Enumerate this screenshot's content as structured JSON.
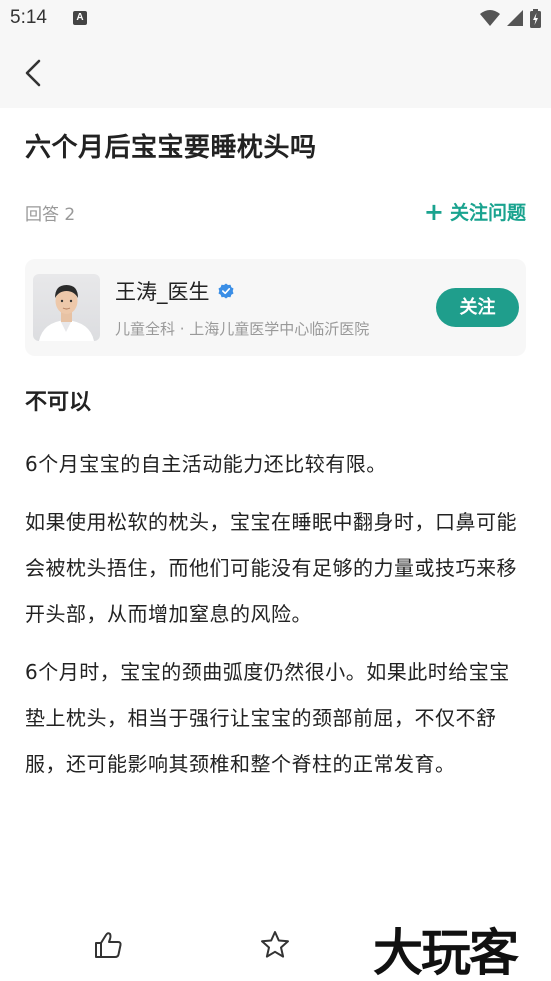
{
  "status_bar": {
    "time": "5:14",
    "notification_glyph": "A",
    "icons": [
      "wifi-icon",
      "signal-icon",
      "battery-charging-icon"
    ]
  },
  "nav": {
    "back_icon": "chevron-left-icon"
  },
  "question": {
    "title": "六个月后宝宝要睡枕头吗",
    "answer_count": "回答 2",
    "follow_label": "关注问题",
    "accent_color": "#1aa38f"
  },
  "doctor": {
    "name": "王涛_医生",
    "verified_icon": "verified-badge-icon",
    "meta": "儿童全科 · 上海儿童医学中心临沂医院",
    "follow_label": "关注"
  },
  "answer": {
    "heading": "不可以",
    "paragraphs": [
      "6个月宝宝的自主活动能力还比较有限。",
      "如果使用松软的枕头，宝宝在睡眠中翻身时，口鼻可能会被枕头捂住，而他们可能没有足够的力量或技巧来移开头部，从而增加窒息的风险。",
      "6个月时，宝宝的颈曲弧度仍然很小。如果此时给宝宝垫上枕头，相当于强行让宝宝的颈部前屈，不仅不舒服，还可能影响其颈椎和整个脊柱的正常发育。"
    ]
  },
  "bottom_bar": {
    "like_icon": "thumbs-up-icon",
    "favorite_icon": "star-icon",
    "watermark": "大玩客"
  }
}
